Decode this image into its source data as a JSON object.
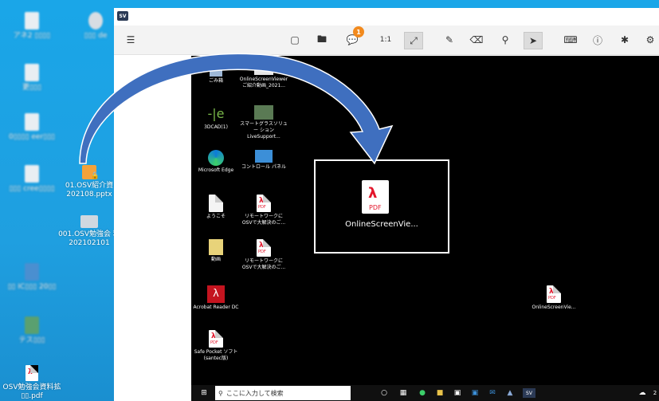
{
  "local_desktop": {
    "icons": [
      {
        "label": "アネ2 ▯▯▯▯",
        "blurred": true
      },
      {
        "label": "▯▯▯ de",
        "blurred": true
      },
      {
        "label": "更▯▯▯",
        "blurred": true
      },
      {
        "label": "0▯▯▯▯ eer▯▯▯",
        "blurred": true
      },
      {
        "label": "▯▯▯ cree▯▯▯▯",
        "blurred": true
      },
      {
        "label": "01.OSV紹介資 202108.pptx",
        "blurred": false
      },
      {
        "label": "001.OSV勉強会 料202102101",
        "blurred": false
      },
      {
        "label": "▯▯ IC▯▯▯ 20▯▯",
        "blurred": true
      },
      {
        "label": "テス▯▯▯",
        "blurred": true
      },
      {
        "label": "OSV勉強会資料拡 ▯▯.pdf",
        "blurred": false
      }
    ]
  },
  "viewer": {
    "logo": "SV",
    "toolbar": {
      "menu_icon": "menu-icon",
      "notification_count": "1",
      "scale_label": "1:1"
    }
  },
  "remote": {
    "icons": [
      {
        "label": "ごみ箱",
        "kind": "recycle"
      },
      {
        "label": "OnlineScreenViewer ご紹介動画_2021...",
        "kind": "video"
      },
      {
        "label": "3DCAD(1)",
        "kind": "cad"
      },
      {
        "label": "スマートグラスソリュー ションLiveSupport...",
        "kind": "video"
      },
      {
        "label": "Microsoft Edge",
        "kind": "edge"
      },
      {
        "label": "コントロール パネル",
        "kind": "control"
      },
      {
        "label": "ようこそ",
        "kind": "doc"
      },
      {
        "label": "リモートワークに OSVで大解決のご...",
        "kind": "pdf"
      },
      {
        "label": "動画",
        "kind": "folder"
      },
      {
        "label": "リモートワークに OSVで大解決のご...",
        "kind": "pdf"
      },
      {
        "label": "Acrobat Reader DC",
        "kind": "acrobat"
      },
      {
        "label": "Safe Pocket ソフト (santec版)",
        "kind": "pdf"
      }
    ],
    "highlight_file": {
      "label": "OnlineScreenVie...",
      "pdf_text": "PDF"
    },
    "dropped_file": {
      "label": "OnlineScreenVie...",
      "pdf_text": "PDF"
    },
    "taskbar": {
      "search_placeholder": "ここに入力して検索",
      "clock_fragment": "2",
      "app_label": "SV"
    }
  },
  "colors": {
    "desktop_blue": "#1aa6e8",
    "pdf_red": "#e3162b",
    "arrow_blue": "#3f6fbf",
    "badge_orange": "#f28a1e"
  }
}
